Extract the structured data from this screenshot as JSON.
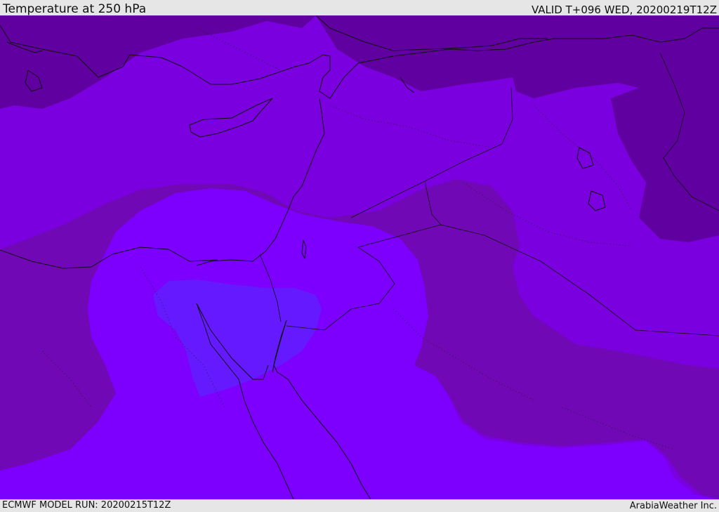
{
  "header": {
    "title": "Temperature at 250 hPa",
    "valid": "VALID T+096 WED, 20200219T12Z"
  },
  "footer": {
    "model_run": "ECMWF MODEL RUN: 20200215T12Z",
    "credit": "ArabiaWeather Inc."
  },
  "map": {
    "colors": {
      "coldest": "#6000a0",
      "cold": "#7108b6",
      "cool": "#7a00df",
      "mild": "#7d00ff",
      "warm": "#6519ff"
    }
  }
}
